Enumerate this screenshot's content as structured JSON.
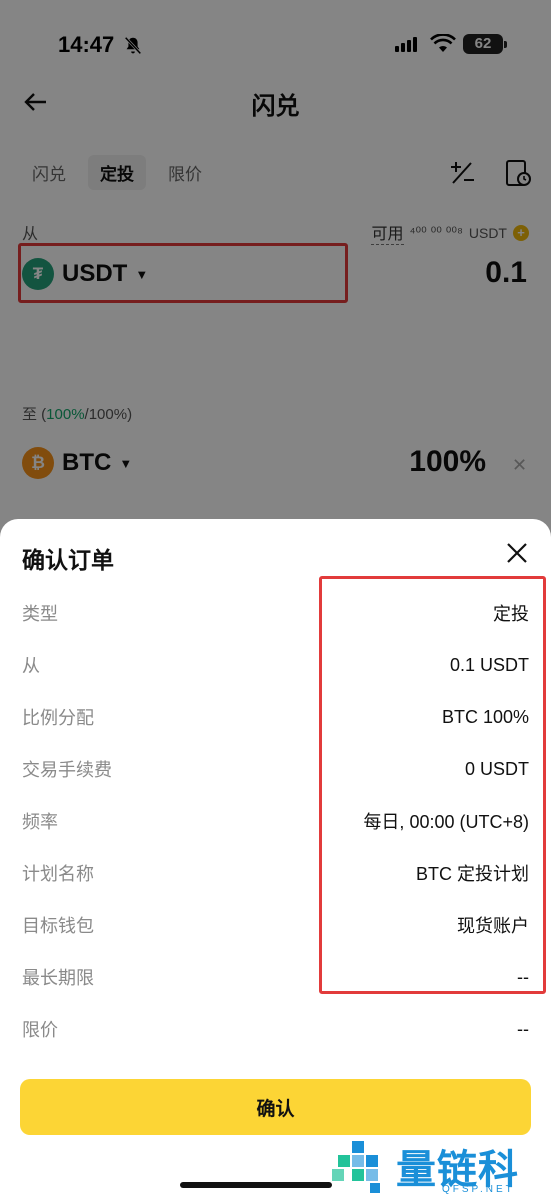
{
  "status_bar": {
    "time": "14:47",
    "battery": "62"
  },
  "nav": {
    "title": "闪兑"
  },
  "tabs": [
    {
      "label": "闪兑",
      "active": false
    },
    {
      "label": "定投",
      "active": true
    },
    {
      "label": "限价",
      "active": false
    }
  ],
  "from": {
    "label": "从",
    "available_label": "可用",
    "available_value": "⁴⁰⁰ ⁰⁰ ⁰⁰⁸",
    "available_unit": "USDT",
    "coin": "USDT",
    "amount": "0.1"
  },
  "to": {
    "label_prefix": "至 (",
    "label_pct": "100%",
    "label_suffix": "/100%)",
    "coin": "BTC",
    "amount": "100%"
  },
  "sheet": {
    "title": "确认订单",
    "rows": [
      {
        "label": "类型",
        "value": "定投"
      },
      {
        "label": "从",
        "value": "0.1 USDT"
      },
      {
        "label": "比例分配",
        "value": "BTC 100%"
      },
      {
        "label": "交易手续费",
        "value": "0 USDT"
      },
      {
        "label": "频率",
        "value": "每日, 00:00 (UTC+8)"
      },
      {
        "label": "计划名称",
        "value": "BTC 定投计划"
      },
      {
        "label": "目标钱包",
        "value": "现货账户"
      },
      {
        "label": "最长期限",
        "value": "--"
      },
      {
        "label": "限价",
        "value": "--"
      }
    ],
    "confirm_label": "确认"
  },
  "watermark": {
    "text": "量链科技",
    "sub": "QFSP.NET"
  },
  "colors": {
    "accent_yellow": "#fcd535",
    "highlight_red": "#e23b3b",
    "usdt_green": "#26a17b",
    "btc_orange": "#f7931a",
    "watermark_blue": "#1a8fd8"
  }
}
